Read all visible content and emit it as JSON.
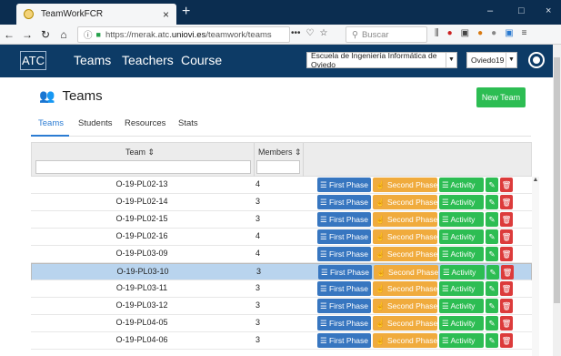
{
  "browser": {
    "tab_title": "TeamWorkFCR",
    "tab_close": "×",
    "new_tab": "+",
    "win_min": "–",
    "win_max": "□",
    "win_close": "×",
    "url_prefix": "https://merak.atc.",
    "url_host": "uniovi.es",
    "url_path": "/teamwork/teams",
    "search_placeholder": "Buscar",
    "more": "•••"
  },
  "app": {
    "logo": "ATC",
    "nav": [
      "Teams",
      "Teachers",
      "Course"
    ],
    "school": "Escuela de Ingeniería Informática de Oviedo",
    "course": "Oviedo19"
  },
  "page": {
    "title": "Teams",
    "new_button": "New Team",
    "tabs": [
      "Teams",
      "Students",
      "Resources",
      "Stats"
    ]
  },
  "table": {
    "headers": {
      "team": "Team ⇕",
      "members": "Members ⇕"
    },
    "actions": {
      "first": "☰ First Phase",
      "second": "☝ Second Phase",
      "activity": "☰ Activity",
      "edit": "✎",
      "delete": "🗑"
    },
    "rows": [
      {
        "team": "O-19-PL02-13",
        "members": "4"
      },
      {
        "team": "O-19-PL02-14",
        "members": "3"
      },
      {
        "team": "O-19-PL02-15",
        "members": "3"
      },
      {
        "team": "O-19-PL02-16",
        "members": "4"
      },
      {
        "team": "O-19-PL03-09",
        "members": "4"
      },
      {
        "team": "O-19-PL03-10",
        "members": "3"
      },
      {
        "team": "O-19-PL03-11",
        "members": "3"
      },
      {
        "team": "O-19-PL03-12",
        "members": "3"
      },
      {
        "team": "O-19-PL04-05",
        "members": "3"
      },
      {
        "team": "O-19-PL04-06",
        "members": "3"
      }
    ]
  }
}
